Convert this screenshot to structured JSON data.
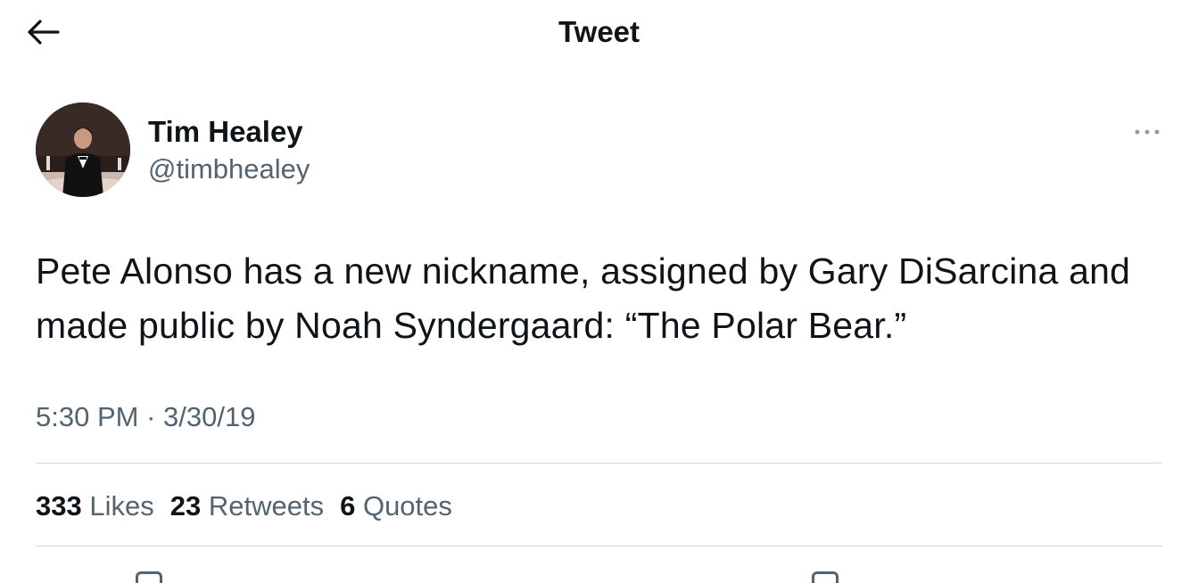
{
  "header": {
    "back_icon": "arrow-left-icon",
    "title": "Tweet"
  },
  "author": {
    "display_name": "Tim Healey",
    "handle": "@timbhealey",
    "avatar_icon": "avatar"
  },
  "tweet": {
    "more_icon": "more-horizontal-icon",
    "text": "Pete Alonso has a new nickname, assigned by Gary DiSarcina and made public by Noah Syndergaard: “The Polar Bear.”",
    "time": "5:30 PM",
    "separator": "·",
    "date": "3/30/19"
  },
  "stats": {
    "likes_count": "333",
    "likes_label": "Likes",
    "retweets_count": "23",
    "retweets_label": "Retweets",
    "quotes_count": "6",
    "quotes_label": "Quotes"
  },
  "colors": {
    "text_primary": "#0f1419",
    "text_secondary": "#536471",
    "divider": "#cfd9de"
  }
}
